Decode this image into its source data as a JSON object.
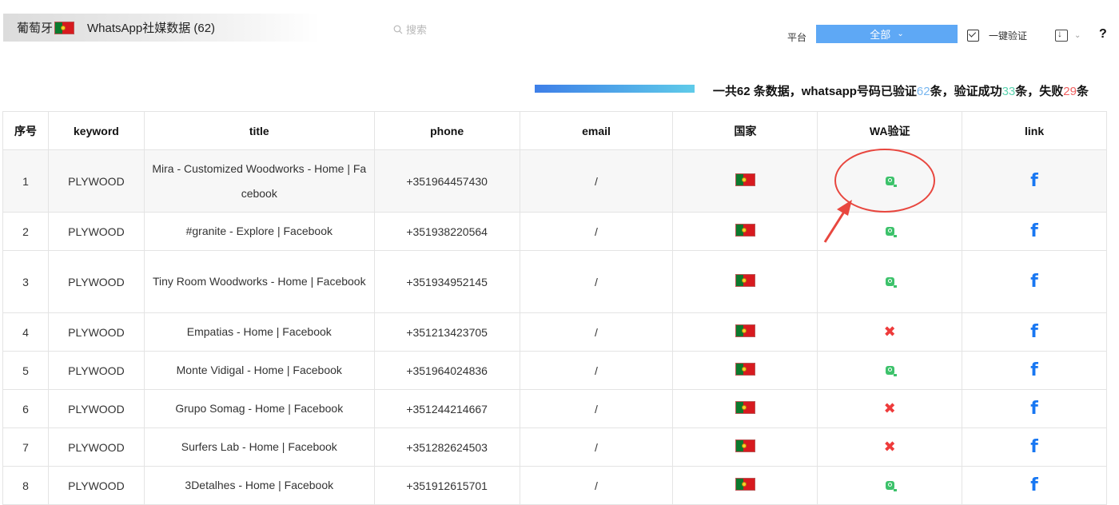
{
  "header": {
    "country": "葡萄牙",
    "tab_title": "WhatsApp社媒数据 (62)"
  },
  "search": {
    "placeholder": "搜索"
  },
  "platform": {
    "label": "平台",
    "selected": "全部"
  },
  "actions": {
    "verify_label": "一键验证",
    "help": "?"
  },
  "summary": {
    "progress_fraction": 1.0,
    "prefix": "一共62 条数据，whatsapp号码已验证",
    "verified": "62",
    "mid1": "条，验证成功",
    "success": "33",
    "mid2": "条，失败",
    "fail": "29",
    "suffix": "条"
  },
  "table": {
    "headers": [
      "序号",
      "keyword",
      "title",
      "phone",
      "email",
      "国家",
      "WA验证",
      "link"
    ],
    "rows": [
      {
        "no": "1",
        "keyword": "PLYWOOD",
        "title": "Mira - Customized Woodworks - Home | Facebook",
        "phone": "+351964457430",
        "email": "/",
        "wa": "ok",
        "link": "f"
      },
      {
        "no": "2",
        "keyword": "PLYWOOD",
        "title": "#granite - Explore | Facebook",
        "phone": "+351938220564",
        "email": "/",
        "wa": "ok",
        "link": "f"
      },
      {
        "no": "3",
        "keyword": "PLYWOOD",
        "title": "Tiny Room Woodworks - Home | Facebook",
        "phone": "+351934952145",
        "email": "/",
        "wa": "ok",
        "link": "f"
      },
      {
        "no": "4",
        "keyword": "PLYWOOD",
        "title": "Empatias - Home | Facebook",
        "phone": "+351213423705",
        "email": "/",
        "wa": "fail",
        "link": "f"
      },
      {
        "no": "5",
        "keyword": "PLYWOOD",
        "title": "Monte Vidigal - Home | Facebook",
        "phone": "+351964024836",
        "email": "/",
        "wa": "ok",
        "link": "f"
      },
      {
        "no": "6",
        "keyword": "PLYWOOD",
        "title": "Grupo Somag - Home | Facebook",
        "phone": "+351244214667",
        "email": "/",
        "wa": "fail",
        "link": "f"
      },
      {
        "no": "7",
        "keyword": "PLYWOOD",
        "title": "Surfers Lab - Home | Facebook",
        "phone": "+351282624503",
        "email": "/",
        "wa": "fail",
        "link": "f"
      },
      {
        "no": "8",
        "keyword": "PLYWOOD",
        "title": "3Detalhes - Home | Facebook",
        "phone": "+351912615701",
        "email": "/",
        "wa": "ok",
        "link": "f"
      }
    ]
  },
  "colors": {
    "accent_blue": "#5ea8f5",
    "verified_blue": "#79b7f0",
    "success_green": "#5bd3b0",
    "fail_red": "#f06060",
    "annotation_red": "#e8473f",
    "facebook_blue": "#1877f2"
  },
  "icons": {
    "flag": "portugal-flag-icon",
    "wa_ok": "whatsapp-verified-icon",
    "wa_fail": "cross-icon",
    "link": "facebook-icon"
  }
}
